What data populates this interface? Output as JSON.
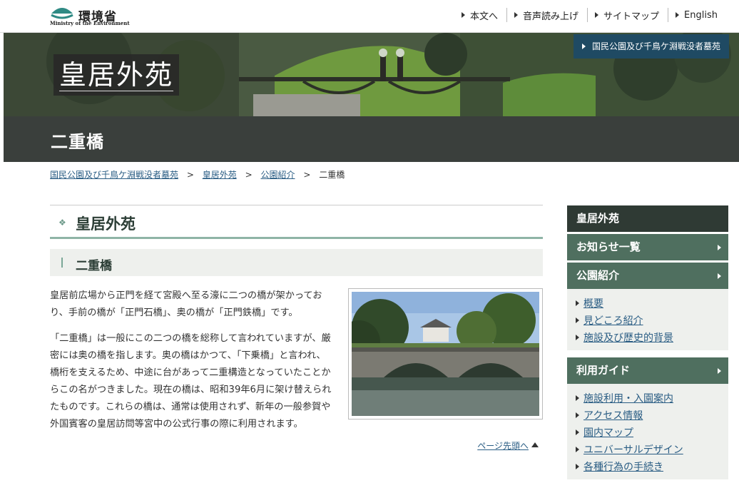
{
  "header": {
    "logo_jp": "環境省",
    "logo_en": "Ministry of the Environment",
    "nav": [
      "本文へ",
      "音声読み上げ",
      "サイトマップ",
      "English"
    ]
  },
  "hero": {
    "title": "皇居外苑",
    "badge": "国民公園及び千鳥ケ淵戦没者墓苑"
  },
  "page_title": "二重橋",
  "breadcrumb": {
    "links": [
      "国民公園及び千鳥ケ淵戦没者墓苑",
      "皇居外苑",
      "公園紹介"
    ],
    "current": "二重橋",
    "separator": ">"
  },
  "main": {
    "section_title": "皇居外苑",
    "sub_title": "二重橋",
    "paragraphs": [
      "皇居前広場から正門を経て宮殿へ至る濠に二つの橋が架かっており、手前の橋が「正門石橋」、奥の橋が「正門鉄橋」です。",
      "「二重橋」は一般にこの二つの橋を総称して言われていますが、厳密には奥の橋を指します。奥の橋はかつて、「下乗橋」と言われ、橋桁を支えるため、中途に台があって二重構造となっていたことからこの名がつきました。現在の橋は、昭和39年6月に架け替えられたものです。これらの橋は、通常は使用されず、新年の一般参賀や外国賓客の皇居訪問等宮中の公式行事の際に利用されます。"
    ],
    "page_top": "ページ先頭へ"
  },
  "sidebar": {
    "top": "皇居外苑",
    "buttons": {
      "news": "お知らせ一覧",
      "intro": "公園紹介",
      "guide": "利用ガイド"
    },
    "intro_items": [
      "概要",
      "見どころ紹介",
      "施設及び歴史的背景"
    ],
    "guide_items": [
      "施設利用・入園案内",
      "アクセス情報",
      "園内マップ",
      "ユニバーサルデザイン",
      "各種行為の手続き"
    ]
  },
  "colors": {
    "title_band": "#3a3f3c",
    "sidebar_dark": "#2f3a34",
    "sidebar_green": "#4f6f5f",
    "accent_line": "#8fb4a6",
    "badge": "#1f4a63",
    "link": "#2a5d84"
  }
}
